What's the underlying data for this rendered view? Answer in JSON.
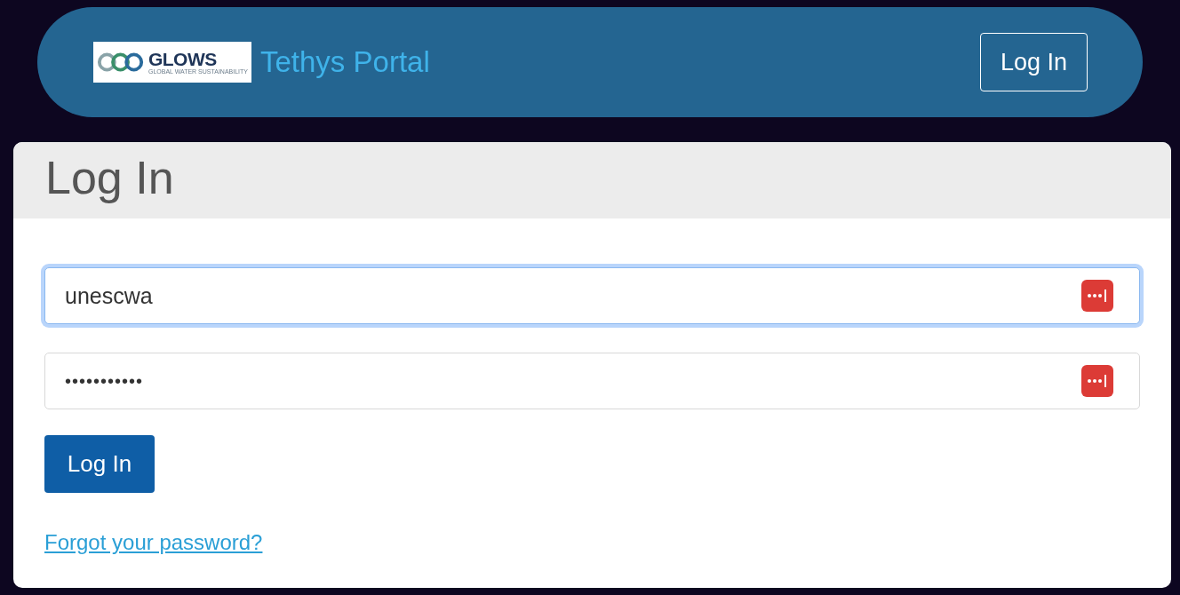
{
  "navbar": {
    "logo": {
      "wordmark": "GLOWS",
      "tagline": "GLOBAL WATER SUSTAINABILITY"
    },
    "title": "Tethys Portal",
    "login_button": "Log In"
  },
  "card": {
    "heading": "Log In",
    "fields": [
      {
        "kind": "text",
        "value": "unescwa",
        "focused": true
      },
      {
        "kind": "password",
        "value": "•••••••••••",
        "focused": false
      }
    ],
    "submit_button": "Log In",
    "forgot_link": "Forgot your password?"
  }
}
